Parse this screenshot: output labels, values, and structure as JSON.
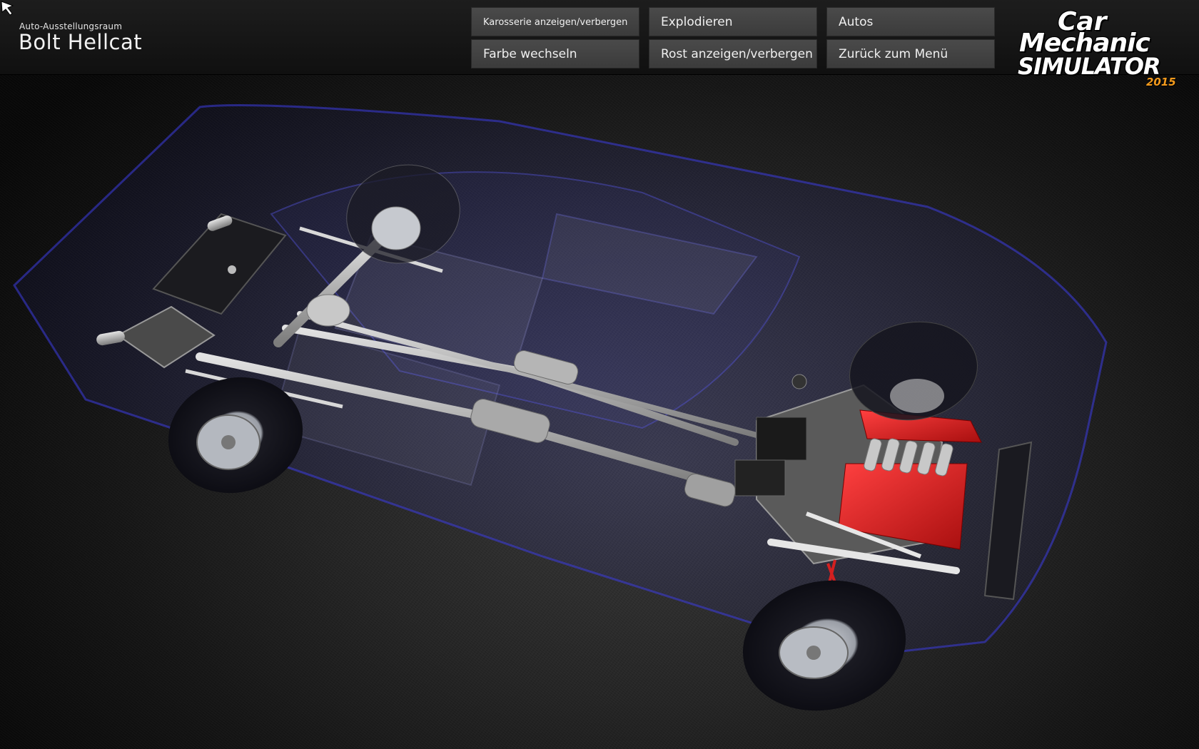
{
  "header": {
    "showroom_label": "Auto-Ausstellungsraum",
    "car_name": "Bolt Hellcat"
  },
  "menu": {
    "toggle_body": "Karosserie anzeigen/verbergen",
    "explode": "Explodieren",
    "cars": "Autos",
    "change_color": "Farbe wechseln",
    "toggle_rust": "Rost anzeigen/verbergen",
    "back_to_menu": "Zurück zum Menü"
  },
  "logo": {
    "line1": "Car",
    "line2": "Mechanic",
    "line3": "SIMULATOR",
    "year": "2015"
  },
  "colors": {
    "body_tint": "#3a3ad8",
    "engine_red": "#d42020",
    "logo_accent": "#f39a1c",
    "button_bg": "#454545"
  }
}
